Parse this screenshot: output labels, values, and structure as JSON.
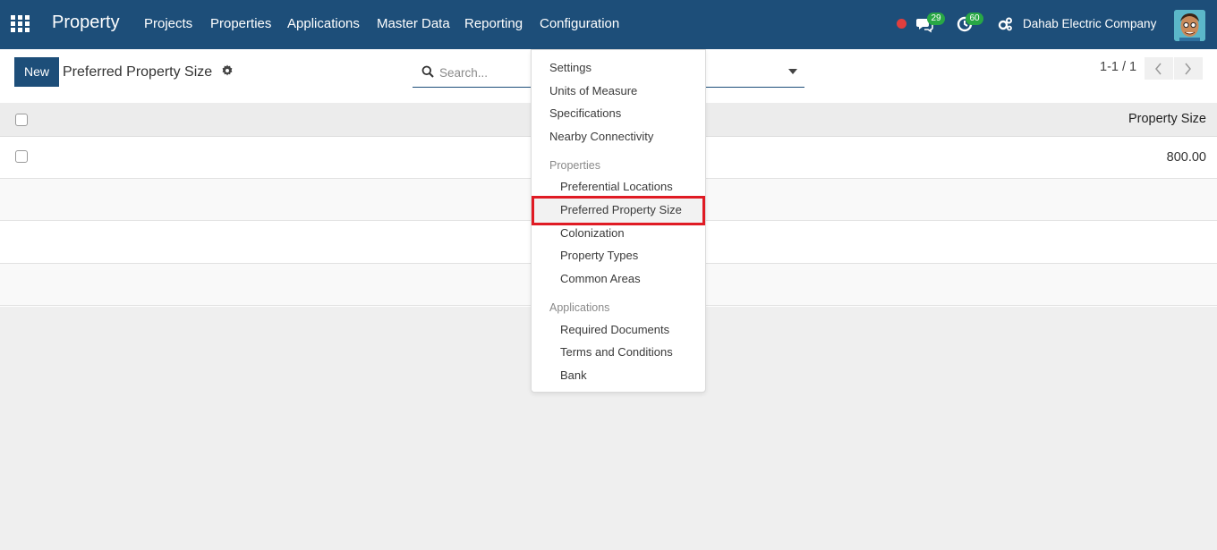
{
  "navbar": {
    "brand": "Property",
    "menu": [
      "Projects",
      "Properties",
      "Applications",
      "Master Data",
      "Reporting",
      "Configuration"
    ],
    "messages_count": "29",
    "activities_count": "60",
    "company": "Dahab Electric Company"
  },
  "control_panel": {
    "new_label": "New",
    "breadcrumb": "Preferred Property Size",
    "search_placeholder": "Search...",
    "pager": "1-1 / 1"
  },
  "list": {
    "column_header": "Property Size",
    "rows": [
      {
        "value": "800.00"
      }
    ]
  },
  "dropdown": {
    "top_items": [
      "Settings",
      "Units of Measure",
      "Specifications",
      "Nearby Connectivity"
    ],
    "properties_header": "Properties",
    "properties_items": [
      "Preferential Locations",
      "Preferred Property Size",
      "Colonization",
      "Property Types",
      "Common Areas"
    ],
    "applications_header": "Applications",
    "applications_items": [
      "Required Documents",
      "Terms and Conditions",
      "Bank"
    ],
    "highlighted": "Preferred Property Size"
  },
  "colors": {
    "navbar": "#1d4e79",
    "badge": "#28a745",
    "record_dot": "#e03e3e",
    "highlight_border": "#e01b24"
  },
  "icons": [
    "apps-grid-icon",
    "chat-icon",
    "activity-clock-icon",
    "company-switch-icon",
    "gear-icon",
    "search-icon",
    "caret-down-icon",
    "chevron-left-icon",
    "chevron-right-icon"
  ]
}
